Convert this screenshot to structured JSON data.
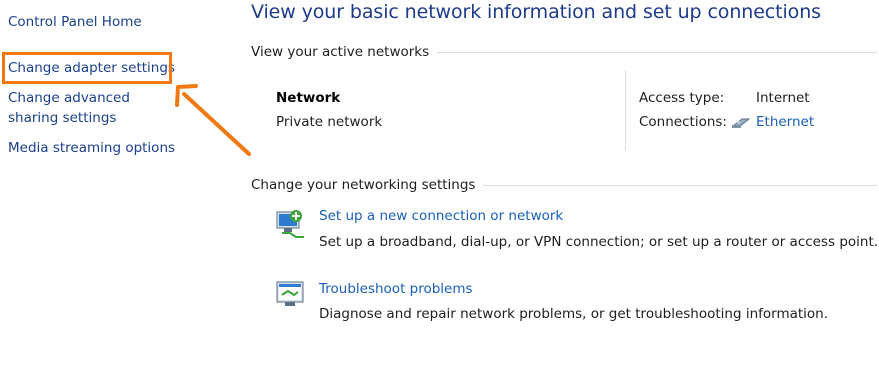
{
  "left_pane": {
    "home": "Control Panel Home",
    "adapter": "Change adapter settings",
    "sharing": "Change advanced sharing settings",
    "media": "Media streaming options"
  },
  "main": {
    "title": "View your basic network information and set up connections",
    "active_header": "View your active networks",
    "network": {
      "name": "Network",
      "type": "Private network",
      "access_label": "Access type:",
      "access_value": "Internet",
      "connections_label": "Connections:",
      "connections_value": "Ethernet",
      "connection_icon": "ethernet-icon"
    },
    "settings_header": "Change your networking settings",
    "tasks": [
      {
        "title": "Set up a new connection or network",
        "desc": "Set up a broadband, dial-up, or VPN connection; or set up a router or access point.",
        "icon": "new-connection-icon"
      },
      {
        "title": "Troubleshoot problems",
        "desc": "Diagnose and repair network problems, or get troubleshooting information.",
        "icon": "troubleshoot-icon"
      }
    ]
  },
  "colors": {
    "highlight": "#f07a11",
    "link": "#1a5fb4",
    "title": "#1e3a8a"
  }
}
